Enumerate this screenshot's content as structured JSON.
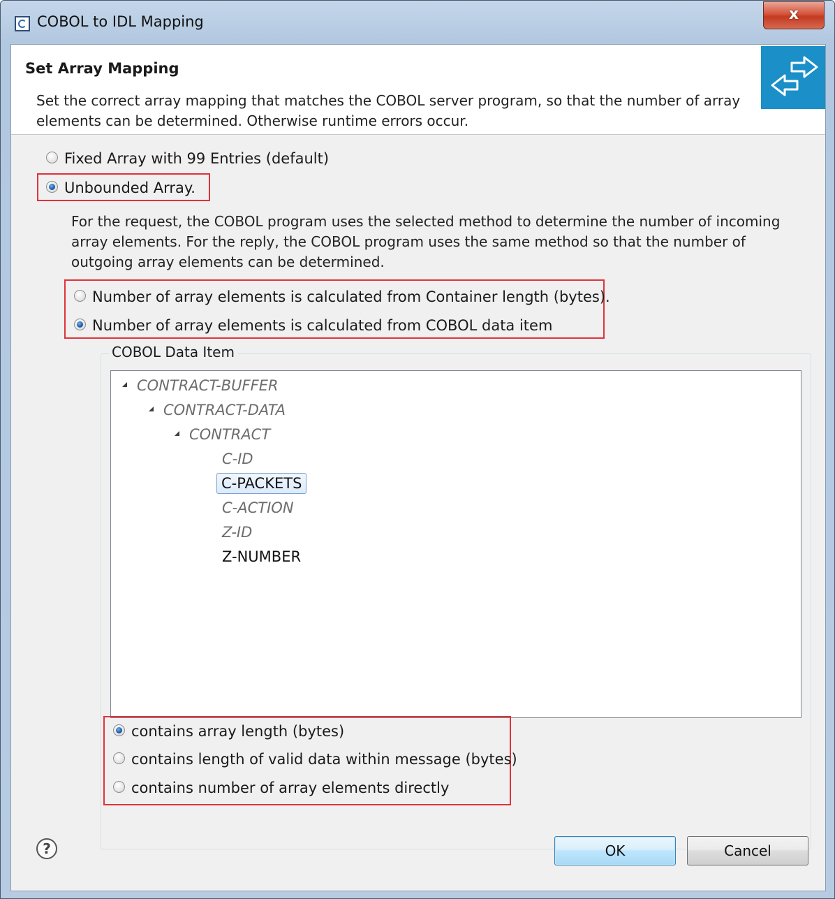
{
  "window": {
    "title": "COBOL to IDL Mapping",
    "close_label": "x"
  },
  "banner": {
    "title": "Set Array Mapping",
    "description": "Set the correct array mapping that matches the COBOL server program, so that the number of array elements can be determined. Otherwise runtime errors occur.",
    "icon": "mapping-arrows-icon",
    "accent_color": "#1a8fc8"
  },
  "array_mode": {
    "options": [
      {
        "label": "Fixed Array with 99 Entries (default)",
        "checked": false
      },
      {
        "label": "Unbounded Array.",
        "checked": true
      }
    ]
  },
  "unbounded": {
    "description": "For the request, the COBOL program uses the selected method to determine the number of incoming array elements. For the reply, the COBOL program uses the same method so that the number of outgoing array elements can be determined.",
    "method_options": [
      {
        "label": "Number of array elements is calculated from Container length (bytes).",
        "checked": false
      },
      {
        "label": "Number of array elements is calculated from COBOL data item",
        "checked": true
      }
    ]
  },
  "data_item_group": {
    "label": "COBOL Data Item",
    "tree": [
      {
        "label": "CONTRACT-BUFFER",
        "expanded": true,
        "italic": true
      },
      {
        "label": "CONTRACT-DATA",
        "expanded": true,
        "italic": true
      },
      {
        "label": "CONTRACT",
        "expanded": true,
        "italic": true
      },
      {
        "label": "C-ID",
        "italic": true
      },
      {
        "label": "C-PACKETS",
        "selected": true
      },
      {
        "label": "C-ACTION",
        "italic": true
      },
      {
        "label": "Z-ID",
        "italic": true
      },
      {
        "label": "Z-NUMBER",
        "italic": false
      }
    ],
    "content_options": [
      {
        "label": "contains array length (bytes)",
        "checked": true
      },
      {
        "label": "contains length of valid data within message (bytes)",
        "checked": false
      },
      {
        "label": "contains number of array elements directly",
        "checked": false
      }
    ]
  },
  "footer": {
    "help_icon": "help-icon",
    "help_glyph": "?",
    "ok_label": "OK",
    "cancel_label": "Cancel"
  },
  "highlight_color": "#e0333a"
}
